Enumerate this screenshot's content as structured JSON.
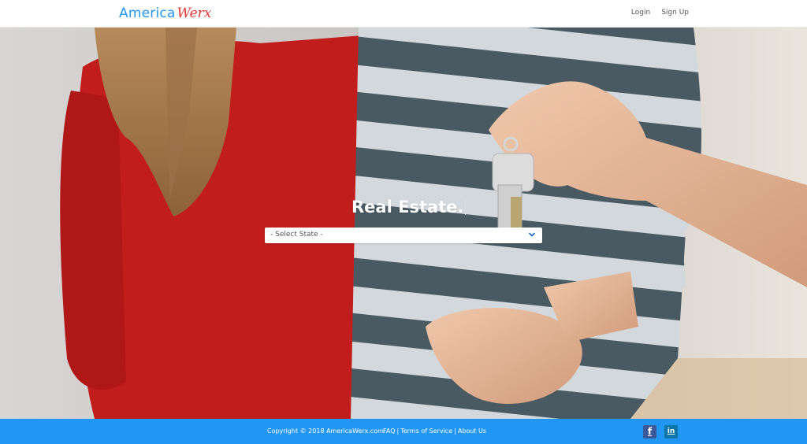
{
  "header": {
    "brand_primary": "America",
    "brand_secondary": "Werx",
    "login_label": "Login",
    "signup_label": "Sign Up"
  },
  "hero": {
    "title": "Real Estate.",
    "state_select_value": "- Select State -"
  },
  "footer": {
    "copyright": "Copyright © 2018 AmericaWerx.com",
    "faq_label": "FAQ",
    "terms_label": "Terms of Service",
    "about_label": "About Us",
    "separator": "|",
    "facebook_glyph": "f",
    "linkedin_glyph": "in"
  },
  "colors": {
    "brand_blue": "#2196f3",
    "brand_red": "#e53935",
    "footer_bg": "#2196f3"
  },
  "icons": {
    "select_chevron": "chevron-down-icon",
    "facebook": "facebook-icon",
    "linkedin": "linkedin-icon"
  }
}
